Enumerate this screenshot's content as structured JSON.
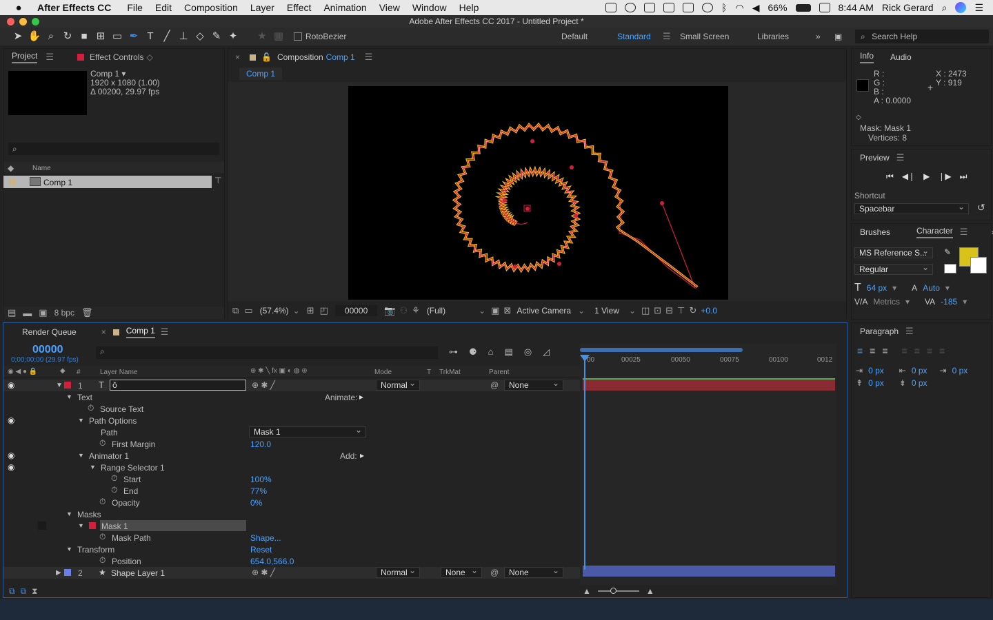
{
  "colors": {
    "accent": "#4aa3ff",
    "layer_red": "#d21f3c",
    "layer_blue": "#6b7ee8",
    "spiral_yellow": "#e8c524",
    "fill_yellow": "#d9c21a"
  },
  "menubar": {
    "app": "After Effects CC",
    "items": [
      "File",
      "Edit",
      "Composition",
      "Layer",
      "Effect",
      "Animation",
      "View",
      "Window",
      "Help"
    ],
    "battery": "66%",
    "time": "8:44 AM",
    "user": "Rick Gerard"
  },
  "window": {
    "title": "Adobe After Effects CC 2017 - Untitled Project *"
  },
  "toolbar": {
    "rotobezier": "RotoBezier",
    "workspaces": [
      "Default",
      "Standard",
      "Small Screen",
      "Libraries"
    ],
    "active_workspace": "Standard",
    "search": "Search Help"
  },
  "project": {
    "tab_project": "Project",
    "tab_effect": "Effect Controls",
    "comp_name": "Comp 1 ▾",
    "comp_size": "1920 x 1080 (1.00)",
    "comp_dur": "Δ 00200, 29.97 fps",
    "col_name": "Name",
    "item": "Comp 1",
    "bpc": "8 bpc"
  },
  "viewer": {
    "tab": "Composition",
    "tab_comp": "Comp 1",
    "subtab": "Comp 1",
    "zoom": "(57.4%)",
    "timecode": "00000",
    "resolution": "(Full)",
    "camera": "Active Camera",
    "views": "1 View",
    "exposure": "+0.0"
  },
  "info": {
    "tab_info": "Info",
    "tab_audio": "Audio",
    "r": "R :",
    "g": "G :",
    "b": "B :",
    "a": "A : 0.0000",
    "x": "X : 2473",
    "y": "Y : 919",
    "mask": "Mask: Mask 1",
    "vertices": "Vertices: 8"
  },
  "preview": {
    "title": "Preview",
    "shortcut_label": "Shortcut",
    "shortcut": "Spacebar"
  },
  "character": {
    "tab_brushes": "Brushes",
    "tab_character": "Character",
    "font": "MS Reference S...",
    "style": "Regular",
    "size": "64 px",
    "leading": "Auto",
    "kerning": "Metrics",
    "tracking": "-185"
  },
  "paragraph": {
    "title": "Paragraph",
    "indent1": "0 px",
    "indent2": "0 px",
    "indent3": "0 px",
    "space1": "0 px",
    "space2": "0 px"
  },
  "timeline": {
    "tab_render": "Render Queue",
    "tab_comp": "Comp 1",
    "timecode": "00000",
    "timecode_sub": "0;00;00;00 (29.97 fps)",
    "col_num": "#",
    "col_layer": "Layer Name",
    "col_mode": "Mode",
    "col_t": "T",
    "col_trkmat": "TrkMat",
    "col_parent": "Parent",
    "ruler": [
      "00",
      "00025",
      "00050",
      "00075",
      "00100",
      "0012"
    ],
    "layer1": {
      "num": "1",
      "name": "ǒ",
      "mode": "Normal",
      "parent": "None"
    },
    "props": [
      {
        "label": "Text",
        "indent": 1,
        "tri": "▼",
        "sw": false,
        "value": "",
        "extra": "Animate:"
      },
      {
        "label": "Source Text",
        "indent": 2,
        "tri": "",
        "sw": true,
        "value": "",
        "extra": ""
      },
      {
        "label": "Path Options",
        "indent": 2,
        "tri": "▼",
        "sw": false,
        "value": "",
        "extra": "",
        "eye": true
      },
      {
        "label": "Path",
        "indent": 3,
        "tri": "",
        "sw": false,
        "value": "",
        "extra": ""
      },
      {
        "label": "First Margin",
        "indent": 3,
        "tri": "",
        "sw": true,
        "value": "120.0",
        "extra": ""
      },
      {
        "label": "Animator 1",
        "indent": 2,
        "tri": "▼",
        "sw": false,
        "value": "",
        "extra": "Add:",
        "eye": true
      },
      {
        "label": "Range Selector 1",
        "indent": 3,
        "tri": "▼",
        "sw": false,
        "value": "",
        "extra": "",
        "eye": true
      },
      {
        "label": "Start",
        "indent": 4,
        "tri": "",
        "sw": true,
        "value": "100%",
        "extra": ""
      },
      {
        "label": "End",
        "indent": 4,
        "tri": "",
        "sw": true,
        "value": "77%",
        "extra": ""
      },
      {
        "label": "Opacity",
        "indent": 3,
        "tri": "",
        "sw": true,
        "value": "0%",
        "extra": ""
      },
      {
        "label": "Masks",
        "indent": 1,
        "tri": "▼",
        "sw": false,
        "value": "",
        "extra": ""
      },
      {
        "label": "Mask 1",
        "indent": 2,
        "tri": "▼",
        "sw": false,
        "value": "",
        "extra": "",
        "mask": true
      },
      {
        "label": "Mask Path",
        "indent": 3,
        "tri": "",
        "sw": true,
        "value": "Shape...",
        "extra": ""
      },
      {
        "label": "Transform",
        "indent": 1,
        "tri": "▼",
        "sw": false,
        "value": "Reset",
        "extra": ""
      },
      {
        "label": "Position",
        "indent": 3,
        "tri": "",
        "sw": true,
        "value": "654.0,566.0",
        "extra": ""
      }
    ],
    "path_value": "Mask 1",
    "layer2": {
      "num": "2",
      "name": "Shape Layer 1",
      "mode": "Normal",
      "trkmat": "None",
      "parent": "None"
    }
  }
}
